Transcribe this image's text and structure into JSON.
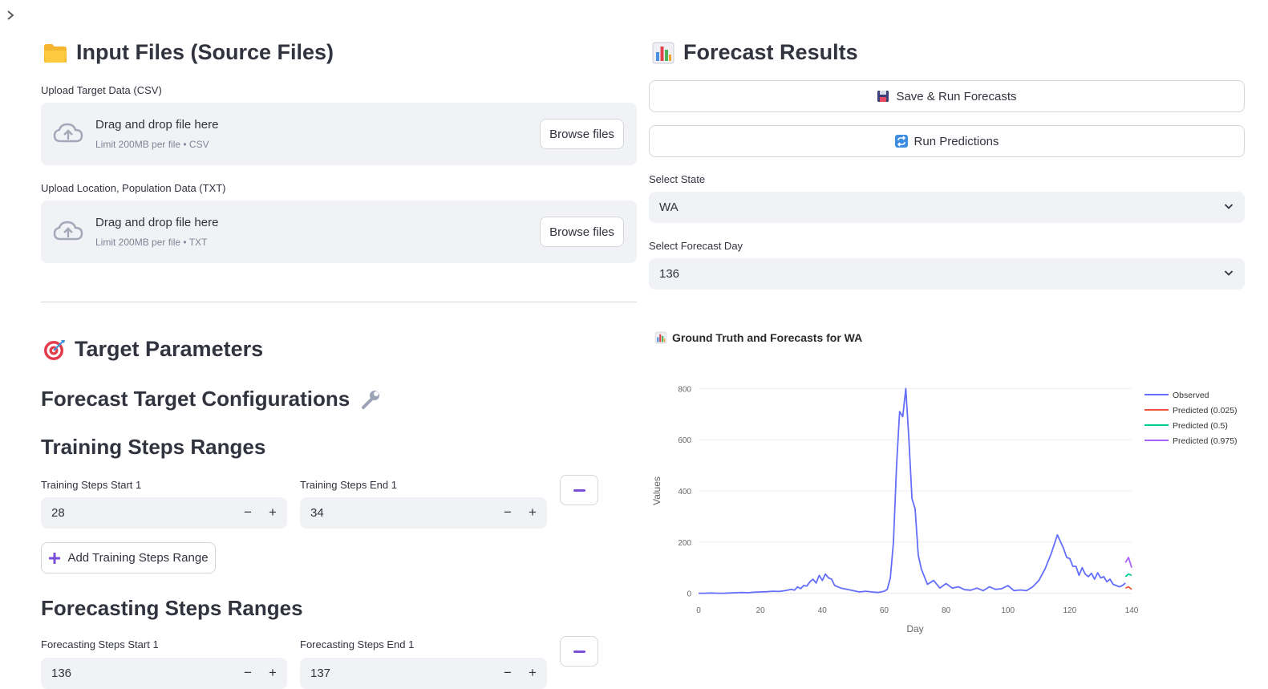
{
  "left": {
    "input_section_title": "Input Files (Source Files)",
    "upload_target": {
      "label": "Upload Target Data (CSV)",
      "drop_title": "Drag and drop file here",
      "drop_hint": "Limit 200MB per file • CSV",
      "browse": "Browse files"
    },
    "upload_location": {
      "label": "Upload Location, Population Data (TXT)",
      "drop_title": "Drag and drop file here",
      "drop_hint": "Limit 200MB per file • TXT",
      "browse": "Browse files"
    },
    "target_params_title": "Target Parameters",
    "forecast_config_title": "Forecast Target Configurations",
    "training_title": "Training Steps Ranges",
    "training_start": {
      "label": "Training Steps Start 1",
      "value": "28"
    },
    "training_end": {
      "label": "Training Steps End 1",
      "value": "34"
    },
    "add_training": "Add Training Steps Range",
    "forecasting_title": "Forecasting Steps Ranges",
    "forecasting_start": {
      "label": "Forecasting Steps Start 1",
      "value": "136"
    },
    "forecasting_end": {
      "label": "Forecasting Steps End 1",
      "value": "137"
    },
    "minus_symbol": "−",
    "plus_symbol": "+"
  },
  "right": {
    "results_title": "Forecast Results",
    "save_run": "Save & Run Forecasts",
    "run_predictions": "Run Predictions",
    "state_label": "Select State",
    "state_value": "WA",
    "day_label": "Select Forecast Day",
    "day_value": "136",
    "chart_heading": "Ground Truth and Forecasts for WA"
  },
  "icons": {
    "sidebar_toggle": "chevron-right-icon",
    "folder": "folder-icon",
    "bar_chart": "bar-chart-icon",
    "target": "target-icon",
    "wrench": "wrench-icon",
    "floppy": "floppy-disk-icon",
    "repeat": "repeat-icon",
    "upload_cloud": "cloud-upload-icon",
    "plus": "plus-icon"
  },
  "colors": {
    "accent": "#7b4fd6",
    "observed": "#636efa",
    "predicted_025": "#ef553b",
    "predicted_05": "#00cc96",
    "predicted_0975": "#ab63fa",
    "input_bg": "#f0f2f6"
  },
  "chart_data": {
    "type": "line",
    "title": "",
    "xlabel": "Day",
    "ylabel": "Values",
    "xlim": [
      0,
      140
    ],
    "ylim": [
      -20,
      820
    ],
    "x_ticks": [
      0,
      20,
      40,
      60,
      80,
      100,
      120,
      140
    ],
    "y_ticks": [
      0,
      200,
      400,
      600,
      800
    ],
    "grid": true,
    "legend_position": "top-right",
    "series": [
      {
        "name": "Observed",
        "color": "#636efa",
        "x": [
          0,
          2,
          4,
          6,
          8,
          10,
          12,
          14,
          16,
          18,
          20,
          22,
          24,
          26,
          28,
          30,
          31,
          32,
          33,
          34,
          35,
          36,
          37,
          38,
          39,
          40,
          41,
          42,
          43,
          44,
          46,
          48,
          50,
          52,
          54,
          56,
          58,
          60,
          61,
          62,
          63,
          64,
          65,
          66,
          67,
          68,
          69,
          70,
          71,
          72,
          74,
          76,
          78,
          80,
          82,
          84,
          86,
          88,
          90,
          92,
          94,
          96,
          98,
          100,
          102,
          104,
          106,
          108,
          110,
          112,
          114,
          116,
          118,
          119,
          120,
          121,
          122,
          123,
          124,
          125,
          126,
          127,
          128,
          129,
          130,
          131,
          132,
          133,
          134,
          135,
          136,
          137,
          138
        ],
        "values": [
          0,
          0,
          1,
          0,
          0,
          1,
          2,
          3,
          2,
          4,
          5,
          6,
          8,
          7,
          10,
          15,
          12,
          25,
          18,
          30,
          28,
          45,
          55,
          40,
          70,
          50,
          75,
          60,
          55,
          30,
          20,
          15,
          10,
          5,
          8,
          5,
          3,
          8,
          15,
          60,
          200,
          500,
          710,
          690,
          800,
          600,
          370,
          330,
          150,
          95,
          35,
          50,
          20,
          38,
          20,
          25,
          14,
          12,
          20,
          10,
          25,
          15,
          18,
          30,
          10,
          13,
          10,
          25,
          50,
          95,
          155,
          228,
          175,
          140,
          135,
          105,
          105,
          70,
          100,
          75,
          65,
          78,
          55,
          80,
          60,
          65,
          45,
          55,
          35,
          30,
          25,
          30,
          40
        ]
      },
      {
        "name": "Predicted (0.025)",
        "color": "#ef553b",
        "x": [
          138,
          139,
          140
        ],
        "values": [
          20,
          25,
          15
        ]
      },
      {
        "name": "Predicted (0.5)",
        "color": "#00cc96",
        "x": [
          138,
          139,
          140
        ],
        "values": [
          65,
          75,
          70
        ]
      },
      {
        "name": "Predicted (0.975)",
        "color": "#ab63fa",
        "x": [
          138,
          139,
          140
        ],
        "values": [
          120,
          140,
          100
        ]
      }
    ]
  }
}
